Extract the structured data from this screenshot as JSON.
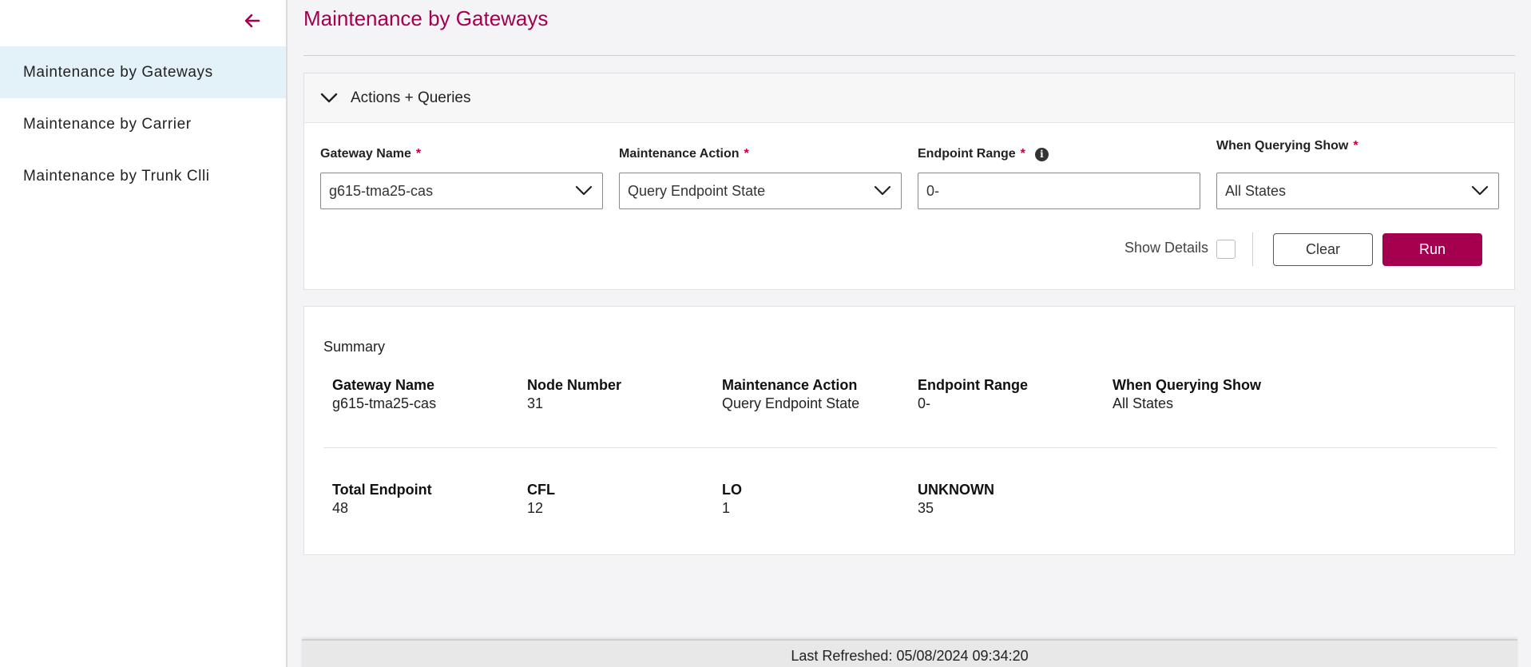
{
  "sidebar": {
    "items": [
      {
        "label": "Maintenance by Gateways",
        "active": true
      },
      {
        "label": "Maintenance by Carrier",
        "active": false
      },
      {
        "label": "Maintenance by Trunk Clli",
        "active": false
      }
    ]
  },
  "page": {
    "title": "Maintenance by Gateways"
  },
  "panel": {
    "title": "Actions + Queries",
    "fields": {
      "gateway_name": {
        "label": "Gateway Name",
        "required": "*",
        "value": "g615-tma25-cas"
      },
      "maintenance_action": {
        "label": "Maintenance Action",
        "required": "*",
        "value": "Query Endpoint State"
      },
      "endpoint_range": {
        "label": "Endpoint Range",
        "required": "*",
        "value": "0-",
        "info_icon": "i"
      },
      "when_querying_show": {
        "label": "When Querying Show",
        "required": "*",
        "value": "All States"
      }
    },
    "show_details_label": "Show Details",
    "show_details_checked": false,
    "clear_label": "Clear",
    "run_label": "Run"
  },
  "summary": {
    "title": "Summary",
    "row1": [
      {
        "label": "Gateway Name",
        "value": "g615-tma25-cas"
      },
      {
        "label": "Node Number",
        "value": "31"
      },
      {
        "label": "Maintenance Action",
        "value": "Query Endpoint State"
      },
      {
        "label": "Endpoint Range",
        "value": "0-"
      },
      {
        "label": "When Querying Show",
        "value": "All States"
      }
    ],
    "row2": [
      {
        "label": "Total Endpoint",
        "value": "48"
      },
      {
        "label": "CFL",
        "value": "12"
      },
      {
        "label": "LO",
        "value": "1"
      },
      {
        "label": "UNKNOWN",
        "value": "35"
      }
    ]
  },
  "footer": {
    "last_refreshed": "Last Refreshed: 05/08/2024 09:34:20"
  },
  "colors": {
    "brand": "#a4004f",
    "active_nav": "#e3f1f8"
  }
}
